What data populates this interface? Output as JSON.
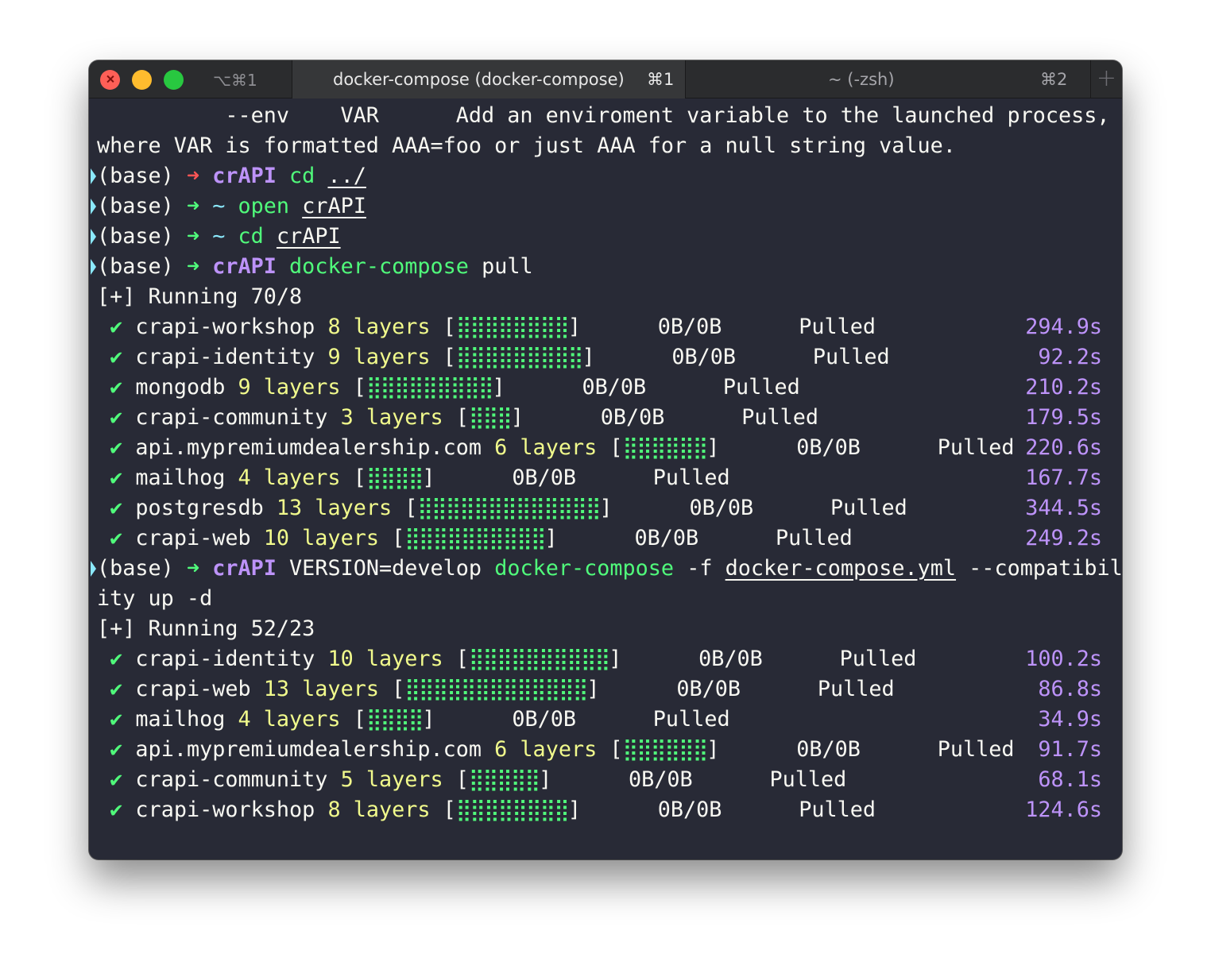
{
  "titlebar": {
    "shortcut_left": "⌥⌘1",
    "tabs": [
      {
        "title": "docker-compose (docker-compose)",
        "shortcut": "⌘1",
        "active": true
      },
      {
        "title": "~ (-zsh)",
        "shortcut": "⌘2",
        "active": false
      }
    ],
    "add_tab": "+"
  },
  "terminal": {
    "help_text": [
      "          --env    VAR      Add an enviroment variable to the launched process,",
      "where VAR is formatted AAA=foo or just AAA for a null string value."
    ],
    "prompt_prefix": "(base)",
    "prompt_arrow": "➜",
    "commands": [
      {
        "dir": "crAPI",
        "cmd": "cd",
        "arg": "../"
      },
      {
        "dir": "~",
        "cmd": "open",
        "arg": "crAPI"
      },
      {
        "dir": "~",
        "cmd": "cd",
        "arg": "crAPI"
      },
      {
        "dir": "crAPI",
        "cmd": "docker-compose",
        "rest": "pull"
      },
      {
        "dir": "crAPI",
        "pre": "VERSION=develop",
        "cmd": "docker-compose",
        "flag": "-f",
        "file": "docker-compose.yml",
        "rest": "--compatibil",
        "wrap": "ity up -d"
      }
    ],
    "run1": {
      "header": "[+] Running 70/8",
      "items": [
        {
          "check": "✔",
          "name": "crapi-workshop",
          "layers": "8 layers",
          "bar": "⣿⣿⣿⣿⣿⣿⣿⣿",
          "size": "0B/0B",
          "status": "Pulled",
          "time": "294.9s"
        },
        {
          "check": "✔",
          "name": "crapi-identity",
          "layers": "9 layers",
          "bar": "⣿⣿⣿⣿⣿⣿⣿⣿⣿",
          "size": "0B/0B",
          "status": "Pulled",
          "time": "92.2s"
        },
        {
          "check": "✔",
          "name": "mongodb",
          "layers": "9 layers",
          "bar": "⣿⣿⣿⣿⣿⣿⣿⣿⣿",
          "size": "0B/0B",
          "status": "Pulled",
          "time": "210.2s"
        },
        {
          "check": "✔",
          "name": "crapi-community",
          "layers": "3 layers",
          "bar": "⣿⣿⣿",
          "size": "0B/0B",
          "status": "Pulled",
          "time": "179.5s"
        },
        {
          "check": "✔",
          "name": "api.mypremiumdealership.com",
          "layers": "6 layers",
          "bar": "⣿⣿⣿⣿⣿⣿",
          "size": "0B/0B",
          "status": "Pulled",
          "time": "220.6s"
        },
        {
          "check": "✔",
          "name": "mailhog",
          "layers": "4 layers",
          "bar": "⣿⣿⣿⣿",
          "size": "0B/0B",
          "status": "Pulled",
          "time": "167.7s"
        },
        {
          "check": "✔",
          "name": "postgresdb",
          "layers": "13 layers",
          "bar": "⣿⣿⣿⣿⣿⣿⣿⣿⣿⣿⣿⣿⣿",
          "size": "0B/0B",
          "status": "Pulled",
          "time": "344.5s"
        },
        {
          "check": "✔",
          "name": "crapi-web",
          "layers": "10 layers",
          "bar": "⣿⣿⣿⣿⣿⣿⣿⣿⣿⣿",
          "size": "0B/0B",
          "status": "Pulled",
          "time": "249.2s"
        }
      ]
    },
    "run2": {
      "header": "[+] Running 52/23",
      "items": [
        {
          "check": "✔",
          "name": "crapi-identity",
          "layers": "10 layers",
          "bar": "⣿⣿⣿⣿⣿⣿⣿⣿⣿⣿",
          "size": "0B/0B",
          "status": "Pulled",
          "time": "100.2s"
        },
        {
          "check": "✔",
          "name": "crapi-web",
          "layers": "13 layers",
          "bar": "⣿⣿⣿⣿⣿⣿⣿⣿⣿⣿⣿⣿⣿",
          "size": "0B/0B",
          "status": "Pulled",
          "time": "86.8s"
        },
        {
          "check": "✔",
          "name": "mailhog",
          "layers": "4 layers",
          "bar": "⣿⣿⣿⣿",
          "size": "0B/0B",
          "status": "Pulled",
          "time": "34.9s"
        },
        {
          "check": "✔",
          "name": "api.mypremiumdealership.com",
          "layers": "6 layers",
          "bar": "⣿⣿⣿⣿⣿⣿",
          "size": "0B/0B",
          "status": "Pulled",
          "time": "91.7s"
        },
        {
          "check": "✔",
          "name": "crapi-community",
          "layers": "5 layers",
          "bar": "⣿⣿⣿⣿⣿",
          "size": "0B/0B",
          "status": "Pulled",
          "time": "68.1s"
        },
        {
          "check": "✔",
          "name": "crapi-workshop",
          "layers": "8 layers",
          "bar": "⣿⣿⣿⣿⣿⣿⣿⣿",
          "size": "0B/0B",
          "status": "Pulled",
          "time": "124.6s"
        }
      ]
    }
  }
}
